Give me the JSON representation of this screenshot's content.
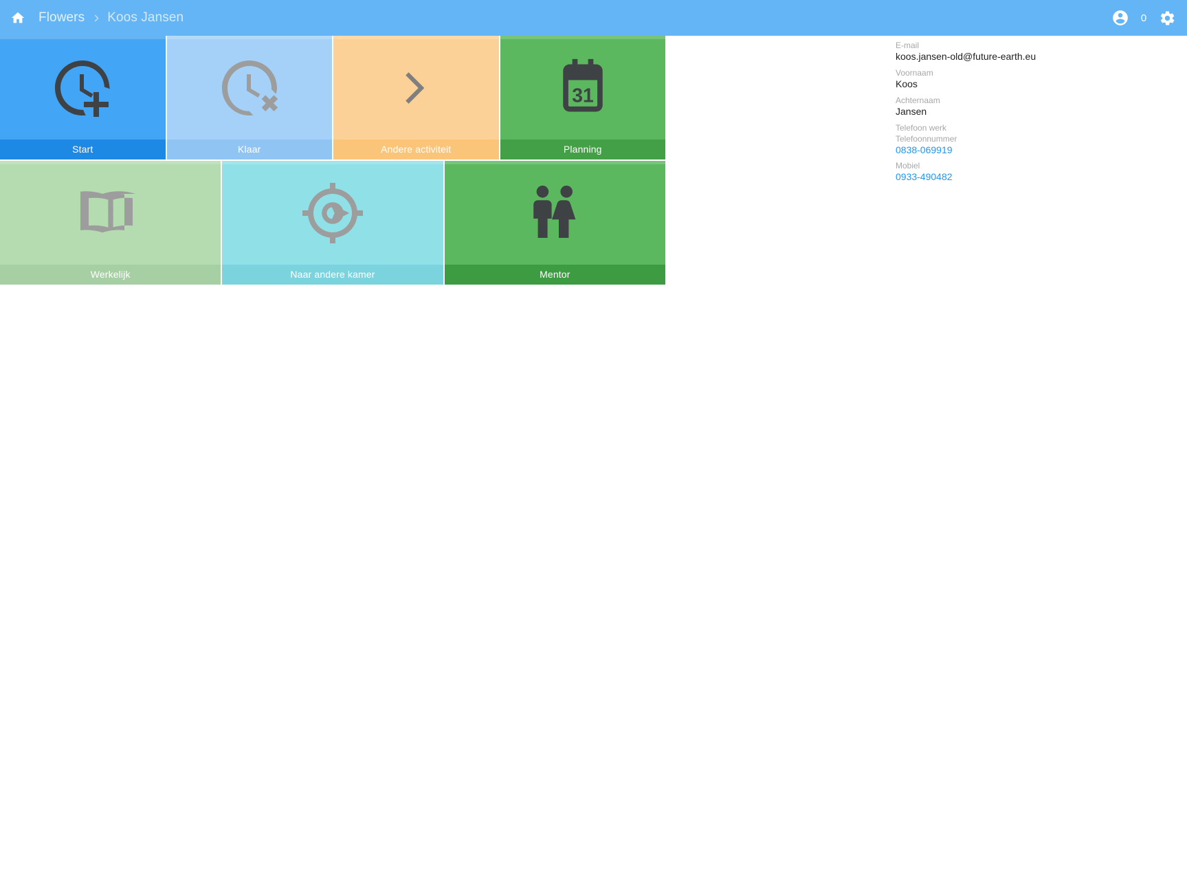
{
  "appbar": {
    "home_icon": "home-icon",
    "breadcrumb": [
      {
        "label": "Flowers",
        "active": false
      },
      {
        "label": "Koos Jansen",
        "active": true
      }
    ],
    "separator": "chevron-right-icon",
    "account_icon": "account-circle-icon",
    "notification_count": "0",
    "settings_icon": "gear-icon",
    "background_color": "#64b5f6"
  },
  "tiles": [
    {
      "id": "start",
      "label": "Start",
      "icon": "clock-plus-icon",
      "bg_color": "#42a5f5",
      "label_bg_color": "#1e88e5",
      "icon_color": "#3f4245",
      "enabled": true
    },
    {
      "id": "klaar",
      "label": "Klaar",
      "icon": "clock-remove-icon",
      "bg_color": "#a5d1f8",
      "label_bg_color": "#90c4f3",
      "icon_color": "#9d9d9d",
      "enabled": false
    },
    {
      "id": "andere-activiteit",
      "label": "Andere activiteit",
      "icon": "chevron-right-icon",
      "bg_color": "#fbd197",
      "label_bg_color": "#fac579",
      "icon_color": "#7f7f7f",
      "enabled": true
    },
    {
      "id": "planning",
      "label": "Planning",
      "icon": "calendar-31-icon",
      "bg_color": "#5cb85f",
      "label_bg_color": "#43a047",
      "icon_color": "#3f4245",
      "enabled": true
    },
    {
      "id": "werkelijk",
      "label": "Werkelijk",
      "icon": "open-book-icon",
      "bg_color": "#b4dcb0",
      "label_bg_color": "#a6d0a3",
      "icon_color": "#9d9d9d",
      "enabled": false
    },
    {
      "id": "naar-andere-kamer",
      "label": "Naar andere kamer",
      "icon": "gps-arrow-icon",
      "bg_color": "#90e0e8",
      "label_bg_color": "#7bd4dd",
      "icon_color": "#9d9d9d",
      "enabled": true
    },
    {
      "id": "mentor",
      "label": "Mentor",
      "icon": "people-man-woman-icon",
      "bg_color": "#5cb85f",
      "label_bg_color": "#3d9c42",
      "icon_color": "#3f4245",
      "enabled": true
    }
  ],
  "info_panel": {
    "email_label": "E-mail",
    "email_value": "koos.jansen-old@future-earth.eu",
    "firstname_label": "Voornaam",
    "firstname_value": "Koos",
    "lastname_label": "Achternaam",
    "lastname_value": "Jansen",
    "workphone_label": "Telefoon werk",
    "phonenumber_label": "Telefoonnummer",
    "phonenumber_value": "0838-069919",
    "mobile_label": "Mobiel",
    "mobile_value": "0933-490482",
    "link_color": "#2196f3"
  }
}
